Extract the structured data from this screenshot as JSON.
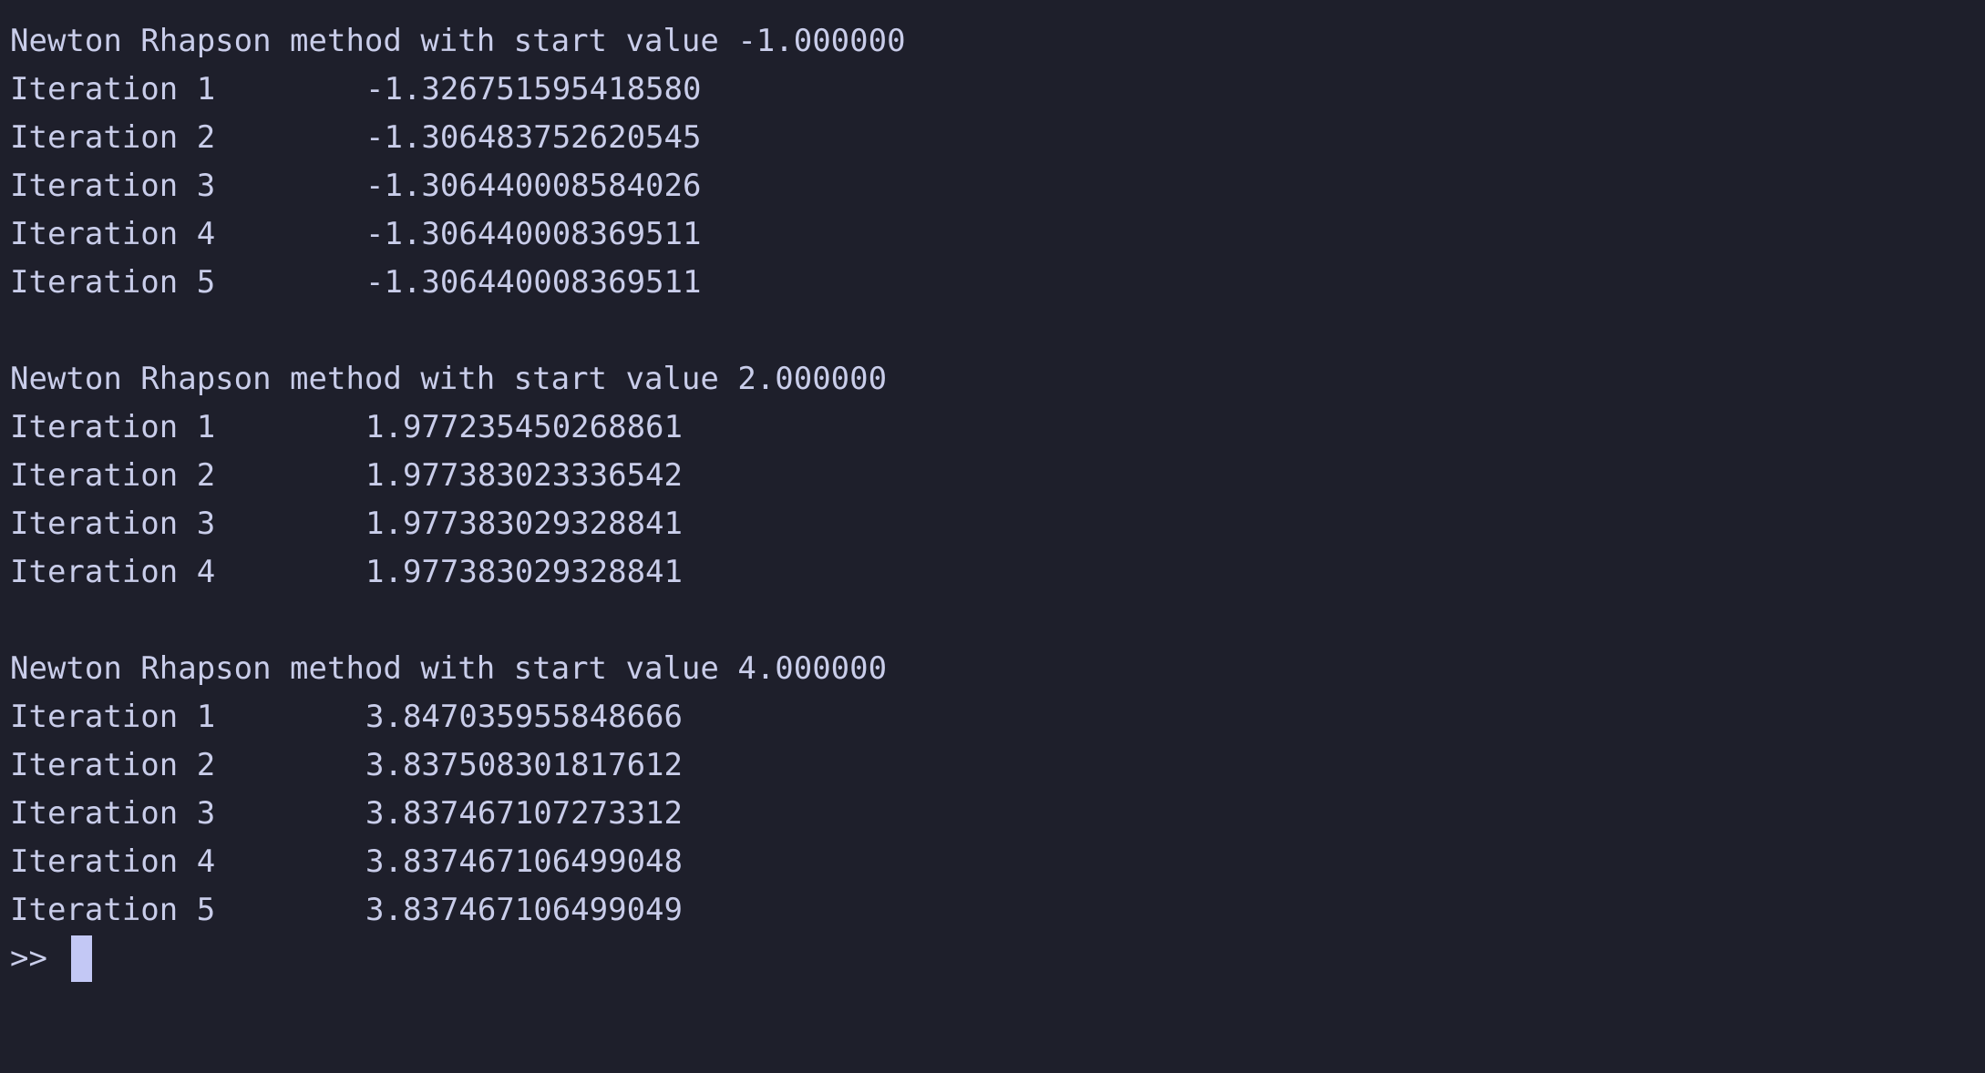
{
  "terminal": {
    "blocks": [
      {
        "header": "Newton Rhapson method with start value -1.000000",
        "iterations": [
          {
            "label": "Iteration 1",
            "value": "-1.326751595418580"
          },
          {
            "label": "Iteration 2",
            "value": "-1.306483752620545"
          },
          {
            "label": "Iteration 3",
            "value": "-1.306440008584026"
          },
          {
            "label": "Iteration 4",
            "value": "-1.306440008369511"
          },
          {
            "label": "Iteration 5",
            "value": "-1.306440008369511"
          }
        ]
      },
      {
        "header": "Newton Rhapson method with start value 2.000000",
        "iterations": [
          {
            "label": "Iteration 1",
            "value": "1.977235450268861"
          },
          {
            "label": "Iteration 2",
            "value": "1.977383023336542"
          },
          {
            "label": "Iteration 3",
            "value": "1.977383029328841"
          },
          {
            "label": "Iteration 4",
            "value": "1.977383029328841"
          }
        ]
      },
      {
        "header": "Newton Rhapson method with start value 4.000000",
        "iterations": [
          {
            "label": "Iteration 1",
            "value": "3.847035955848666"
          },
          {
            "label": "Iteration 2",
            "value": "3.837508301817612"
          },
          {
            "label": "Iteration 3",
            "value": "3.837467107273312"
          },
          {
            "label": "Iteration 4",
            "value": "3.837467106499048"
          },
          {
            "label": "Iteration 5",
            "value": "3.837467106499049"
          }
        ]
      }
    ],
    "prompt": ">>"
  },
  "colors": {
    "background": "#1e1f2b",
    "text": "#c9cdea",
    "cursor": "#c3c8f5"
  }
}
